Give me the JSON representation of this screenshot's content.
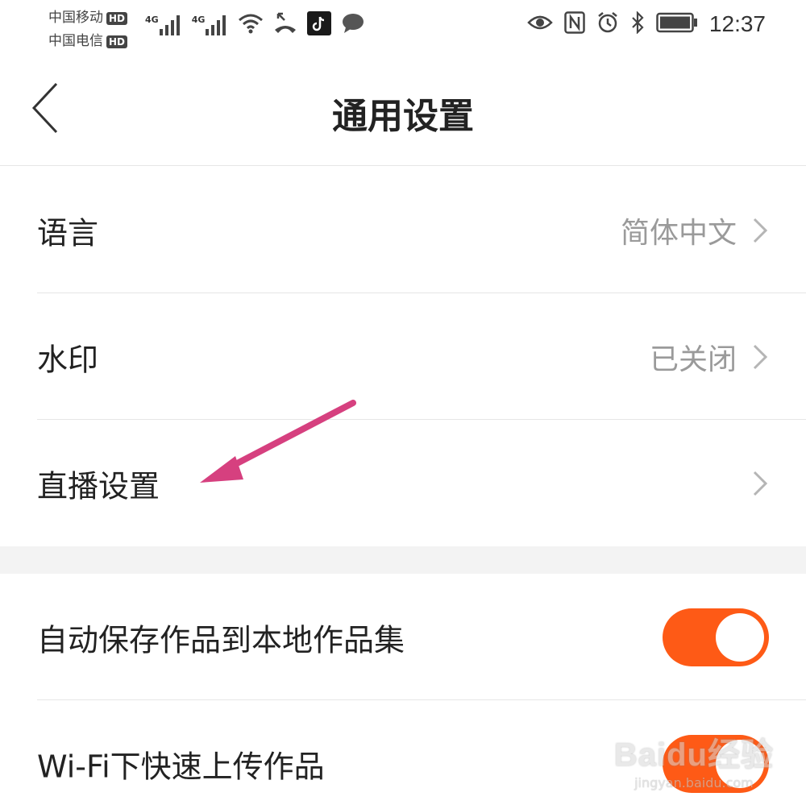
{
  "status_bar": {
    "carrier1": "中国移动",
    "carrier2": "中国电信",
    "hd_badge": "HD",
    "net1": "4G",
    "net2": "4G",
    "time": "12:37"
  },
  "header": {
    "title": "通用设置"
  },
  "settings": {
    "language": {
      "label": "语言",
      "value": "简体中文"
    },
    "watermark": {
      "label": "水印",
      "value": "已关闭"
    },
    "live": {
      "label": "直播设置"
    },
    "auto_save": {
      "label": "自动保存作品到本地作品集",
      "enabled": true
    },
    "wifi_upload": {
      "label": "Wi-Fi下快速上传作品",
      "enabled": true
    }
  },
  "colors": {
    "accent": "#fe5a16",
    "annotation_arrow": "#d6407f"
  },
  "icons": {
    "back": "chevron-left-icon",
    "row_arrow": "chevron-right-icon"
  },
  "watermark_overlay": {
    "brand": "Baidu经验",
    "url": "jingyan.baidu.com"
  }
}
